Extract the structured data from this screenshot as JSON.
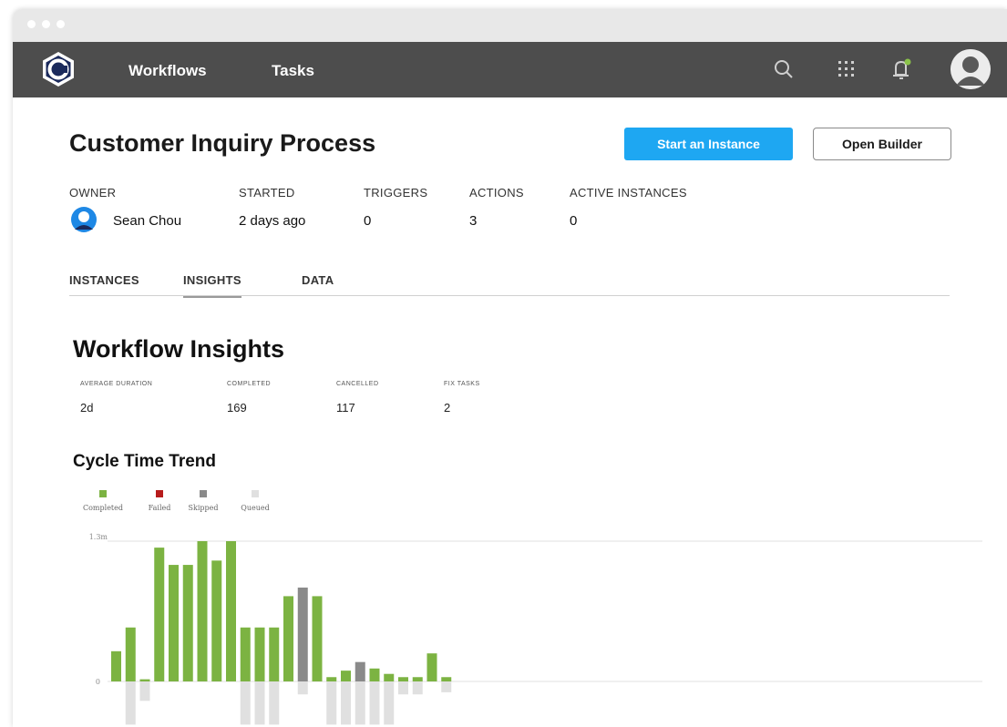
{
  "nav": {
    "links": [
      "Workflows",
      "Tasks"
    ],
    "icons": [
      "search-icon",
      "apps-grid-icon",
      "notification-bell-icon",
      "user-avatar-icon"
    ],
    "notification_dot_color": "#8bc34a"
  },
  "header": {
    "title": "Customer Inquiry Process",
    "start_button": "Start an Instance",
    "builder_button": "Open Builder"
  },
  "meta": {
    "owner_label": "OWNER",
    "owner_value": "Sean Chou",
    "started_label": "STARTED",
    "started_value": "2 days ago",
    "triggers_label": "TRIGGERS",
    "triggers_value": "0",
    "actions_label": "ACTIONS",
    "actions_value": "3",
    "active_label": "ACTIVE INSTANCES",
    "active_value": "0"
  },
  "tabs": [
    "INSTANCES",
    "INSIGHTS",
    "DATA"
  ],
  "active_tab": "INSIGHTS",
  "insights": {
    "title": "Workflow Insights",
    "stats": [
      {
        "label": "AVERAGE DURATION",
        "value": "2d"
      },
      {
        "label": "COMPLETED",
        "value": "169"
      },
      {
        "label": "CANCELLED",
        "value": "117"
      },
      {
        "label": "FIX TASKS",
        "value": "2"
      }
    ]
  },
  "chart_data": {
    "type": "bar",
    "title": "Cycle Time Trend",
    "legend": [
      {
        "name": "Completed",
        "color": "#7cb342"
      },
      {
        "name": "Failed",
        "color": "#b71c1c"
      },
      {
        "name": "Skipped",
        "color": "#8a8a8a"
      },
      {
        "name": "Queued",
        "color": "#e0e0e0"
      }
    ],
    "ytick_labels": [
      "1.3m",
      "0"
    ],
    "ylim": [
      -0.5,
      1.3
    ],
    "grid": true,
    "series": [
      {
        "name": "Completed",
        "values": [
          0.28,
          0.5,
          0.02,
          1.24,
          1.08,
          1.08,
          1.3,
          1.12,
          1.3,
          0.5,
          0.5,
          0.5,
          0.79,
          0,
          0.79,
          0.04,
          0.1,
          0,
          0.12,
          0.07,
          0.04,
          0.04,
          0.26,
          0.04
        ]
      },
      {
        "name": "Skipped",
        "values": [
          0,
          0,
          0,
          0,
          0,
          0,
          0,
          0,
          0,
          0,
          0,
          0,
          0,
          0.87,
          0,
          0,
          0,
          0.18,
          0,
          0,
          0,
          0,
          0,
          0
        ]
      },
      {
        "name": "Queued",
        "values": [
          0,
          -0.4,
          -0.18,
          0,
          0,
          0,
          0,
          0,
          0,
          -0.4,
          -0.4,
          -0.4,
          0,
          -0.12,
          0,
          -0.4,
          -0.4,
          -0.4,
          -0.4,
          -0.4,
          -0.12,
          -0.12,
          0,
          -0.1
        ]
      }
    ]
  }
}
